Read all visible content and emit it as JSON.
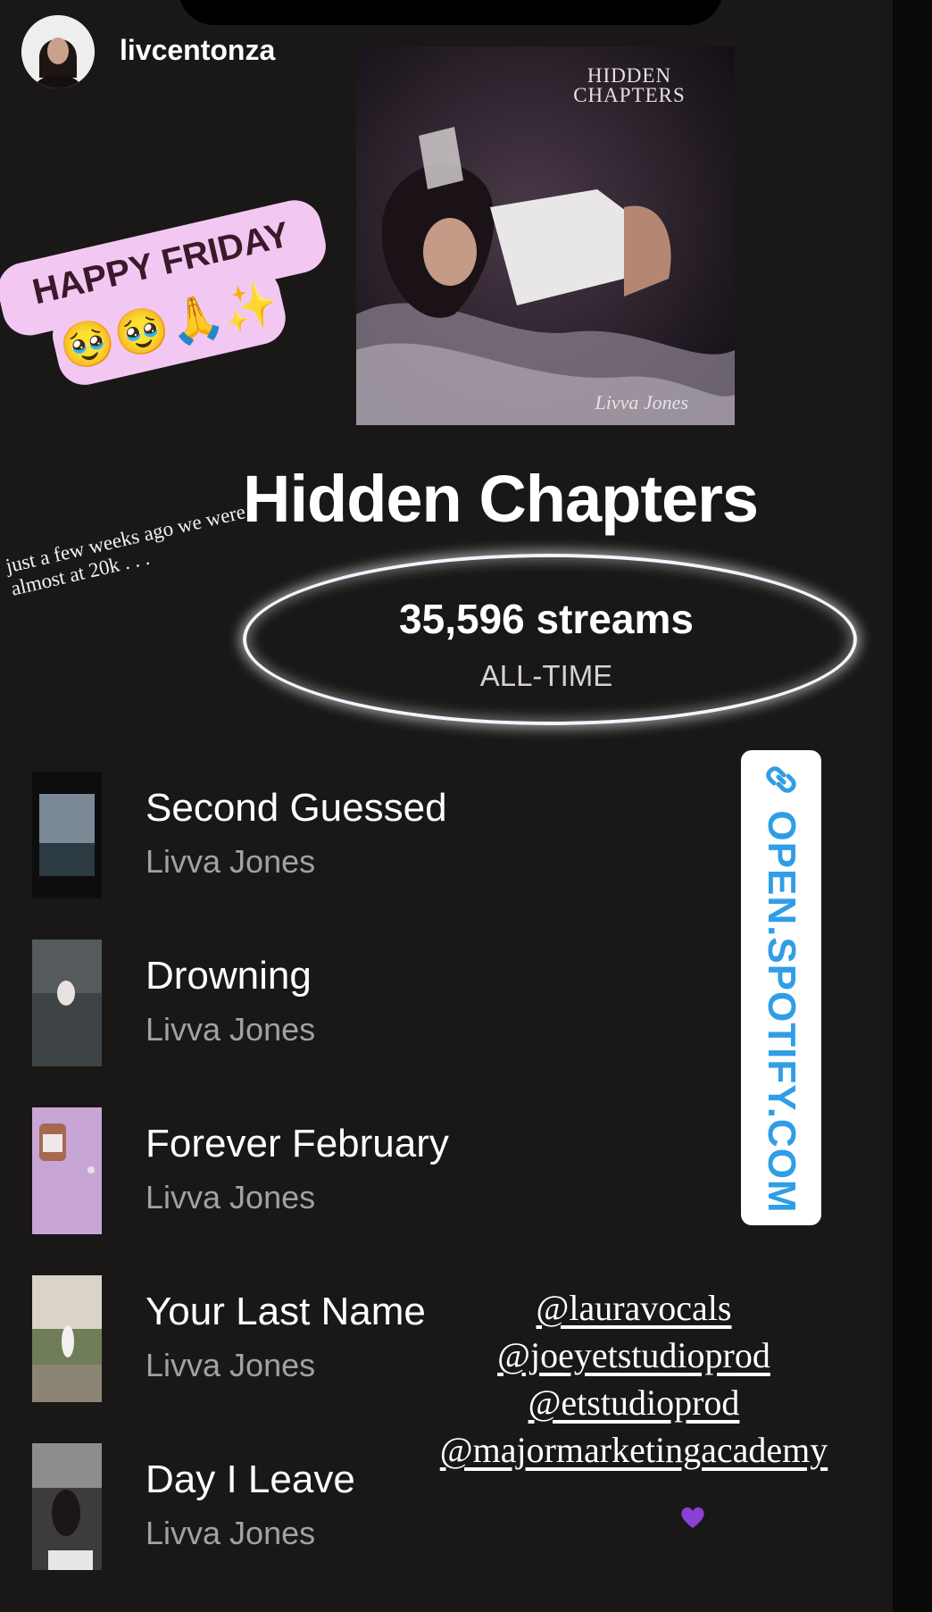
{
  "story": {
    "username": "livcentonza"
  },
  "album": {
    "cover_title": "HIDDEN CHAPTERS",
    "cover_artist": "Livva Jones",
    "title": "Hidden Chapters",
    "streams": "35,596 streams",
    "period": "ALL-TIME"
  },
  "sticker": {
    "text": "HAPPY FRIDAY",
    "emoji": "🥹🥹🙏✨"
  },
  "note": {
    "text": "just a few weeks ago we were almost at 20k . . ."
  },
  "tracks": [
    {
      "title": "Second Guessed",
      "artist": "Livva Jones"
    },
    {
      "title": "Drowning",
      "artist": "Livva Jones"
    },
    {
      "title": "Forever February",
      "artist": "Livva Jones"
    },
    {
      "title": "Your Last Name",
      "artist": "Livva Jones"
    },
    {
      "title": "Day I Leave",
      "artist": "Livva Jones"
    }
  ],
  "link": {
    "text": "OPEN.SPOTIFY.COM",
    "icon": "link-icon"
  },
  "mentions": [
    "@lauravocals",
    "@joeyetstudioprod",
    "@etstudioprod",
    "@majormarketingacademy"
  ],
  "colors": {
    "sticker_bg": "#f2c8f3",
    "link_text": "#2f9ee6",
    "heart": "#8b3fd6"
  }
}
